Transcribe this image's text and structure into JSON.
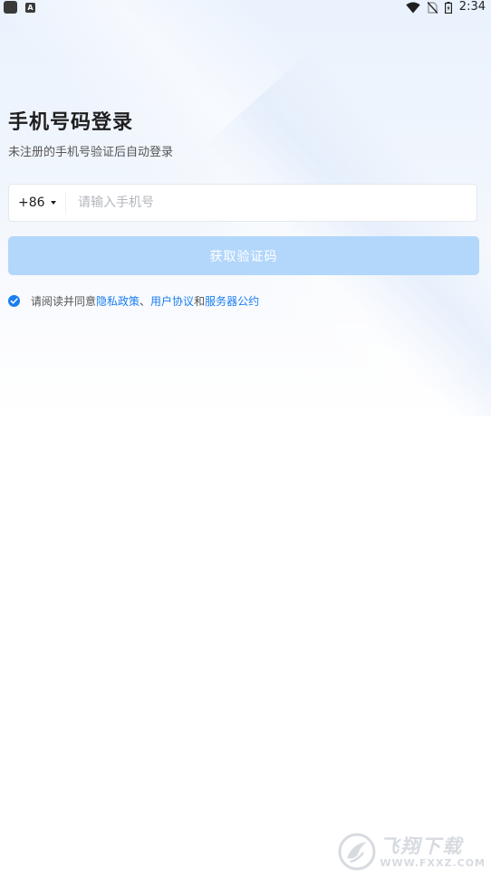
{
  "status_bar": {
    "left_badge": "A",
    "time": "2:34"
  },
  "login": {
    "title": "手机号码登录",
    "subtitle": "未注册的手机号验证后自动登录",
    "country_code": "+86",
    "phone_placeholder": "请输入手机号",
    "phone_value": "",
    "get_code_label": "获取验证码"
  },
  "agreement": {
    "prefix": "请阅读并同意",
    "privacy_link": "隐私政策",
    "separator": "、",
    "user_agreement_link": "用户协议",
    "conjunction": "和",
    "server_link": "服务器公约",
    "checked": true
  },
  "watermark": {
    "title": "飞翔下载",
    "url": "WWW.FXXZ.COM"
  },
  "colors": {
    "accent": "#1a7ef0",
    "button_disabled": "#b3d7fb",
    "background_top": "#eaf2fd"
  }
}
